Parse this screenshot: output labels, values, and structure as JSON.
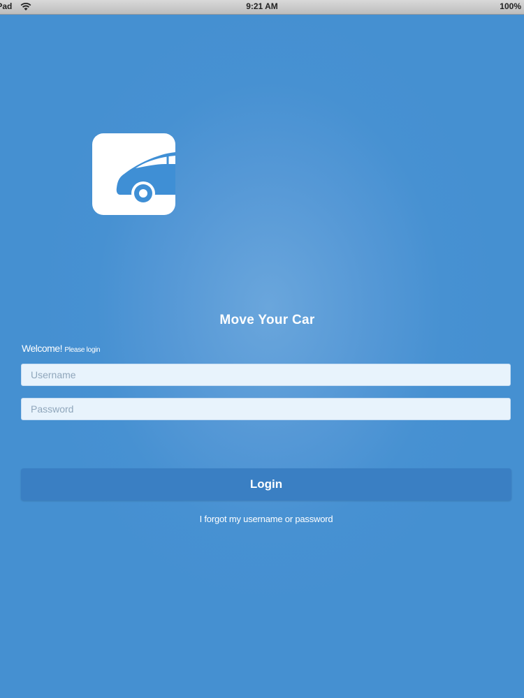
{
  "status_bar": {
    "device": "iPad",
    "time": "9:21 AM",
    "battery": "100%"
  },
  "app": {
    "title": "Move Your Car",
    "icon": "car-icon"
  },
  "login_form": {
    "welcome": "Welcome!",
    "welcome_sub": "Please login",
    "username_placeholder": "Username",
    "password_placeholder": "Password",
    "login_label": "Login",
    "forgot_label": "I forgot my username or password"
  },
  "colors": {
    "background": "#4791d2",
    "button": "#3a7fc3",
    "input_background": "#e8f3fc",
    "icon_car": "#3f8fd5"
  }
}
